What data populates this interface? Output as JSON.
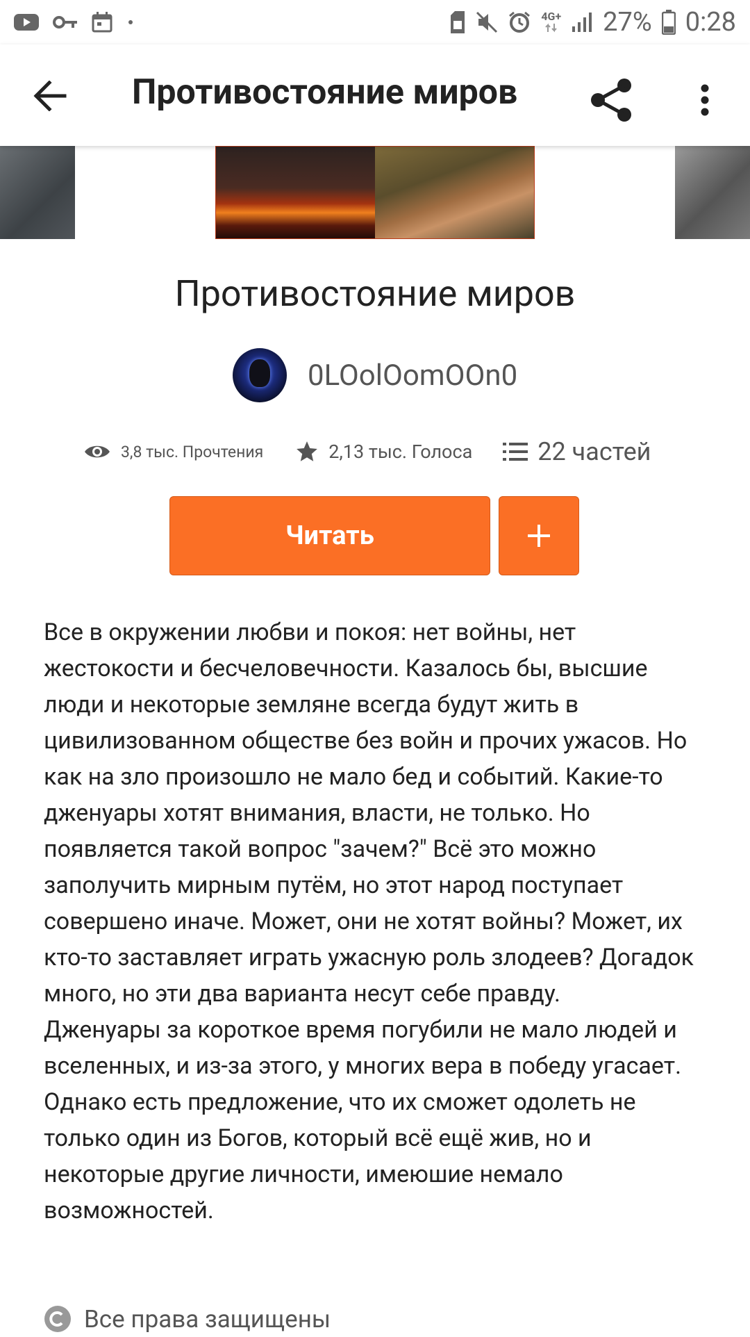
{
  "status_bar": {
    "battery_percent": "27%",
    "time": "0:28",
    "network": "4G+",
    "icons": [
      "youtube-icon",
      "key-icon",
      "calendar-icon",
      "dot-icon",
      "sim-icon",
      "mute-icon",
      "alarm-icon",
      "signal-icon",
      "battery-icon"
    ]
  },
  "app_bar": {
    "title": "Противостояние миров",
    "icons": [
      "back-arrow-icon",
      "share-icon",
      "more-vert-icon"
    ]
  },
  "story": {
    "title": "Противостояние миров",
    "author": "0LOolOomOOn0",
    "stats": {
      "reads": "3,8 тыс. Прочтения",
      "votes": "2,13 тыс. Голоса",
      "parts": "22 частей"
    },
    "read_button": "Читать",
    "add_button_icon": "plus-icon",
    "description": [
      "Все в окружении любви и покоя: нет войны, нет жестокости и бесчеловечности. Казалось бы, высшие люди и некоторые земляне всегда будут жить в цивилизованном обществе без войн и прочих ужасов. Но как на зло произошло не мало бед и событий. Какие-то дженуары хотят внимания, власти, не только. Но появляется такой вопрос \"зачем?\" Всё это можно заполучить мирным путём, но этот народ поступает совершено иначе. Может, они не хотят войны? Может, их кто-то заставляет играть ужасную роль злодеев? Догадок много, но эти два варианта несут себе правду.",
      "Дженуары за короткое время погубили не мало людей и вселенных, и из-за этого, у многих вера в победу угасает. Однако есть предложение, что их сможет одолеть не только один из Богов, который всё ещё жив, но и некоторые другие личности, имеюшие немало возможностей."
    ],
    "copyright": "Все права защищены"
  },
  "colors": {
    "accent": "#fb6f25",
    "text": "#222222",
    "muted": "#555555"
  }
}
